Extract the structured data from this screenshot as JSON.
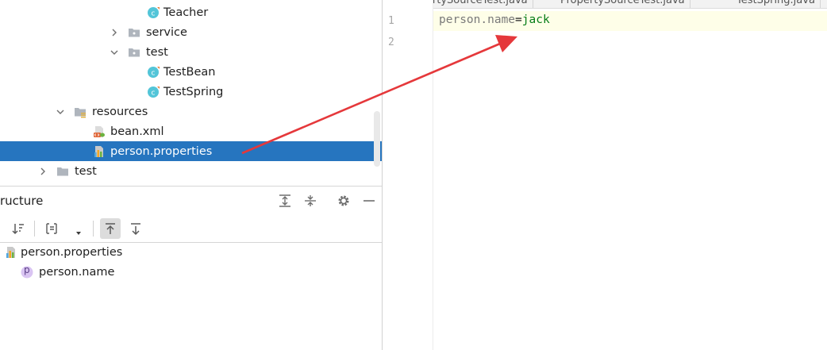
{
  "tree": {
    "teacher": "Teacher",
    "service": "service",
    "test_pkg": "test",
    "testbean": "TestBean",
    "testspring": "TestSpring",
    "resources": "resources",
    "beanxml": "bean.xml",
    "personprops": "person.properties",
    "test_dir": "test"
  },
  "structure": {
    "title": "ructure",
    "file": "person.properties",
    "property": "person.name",
    "prop_badge": "p"
  },
  "editor": {
    "tabs": [
      "PropertySourceTest.java",
      "PropertySourceTest.java",
      "TestSpring.java"
    ],
    "line_numbers": [
      "1",
      "2"
    ],
    "code_key": "person.name",
    "code_eq": "=",
    "code_val": "jack"
  },
  "colors": {
    "selection": "#2675bf",
    "class_icon": "#53c5d8",
    "folder": "#afb5bd",
    "annotation_arrow": "#e5383b",
    "code_value": "#067d17",
    "code_key": "#7a7a7a"
  }
}
